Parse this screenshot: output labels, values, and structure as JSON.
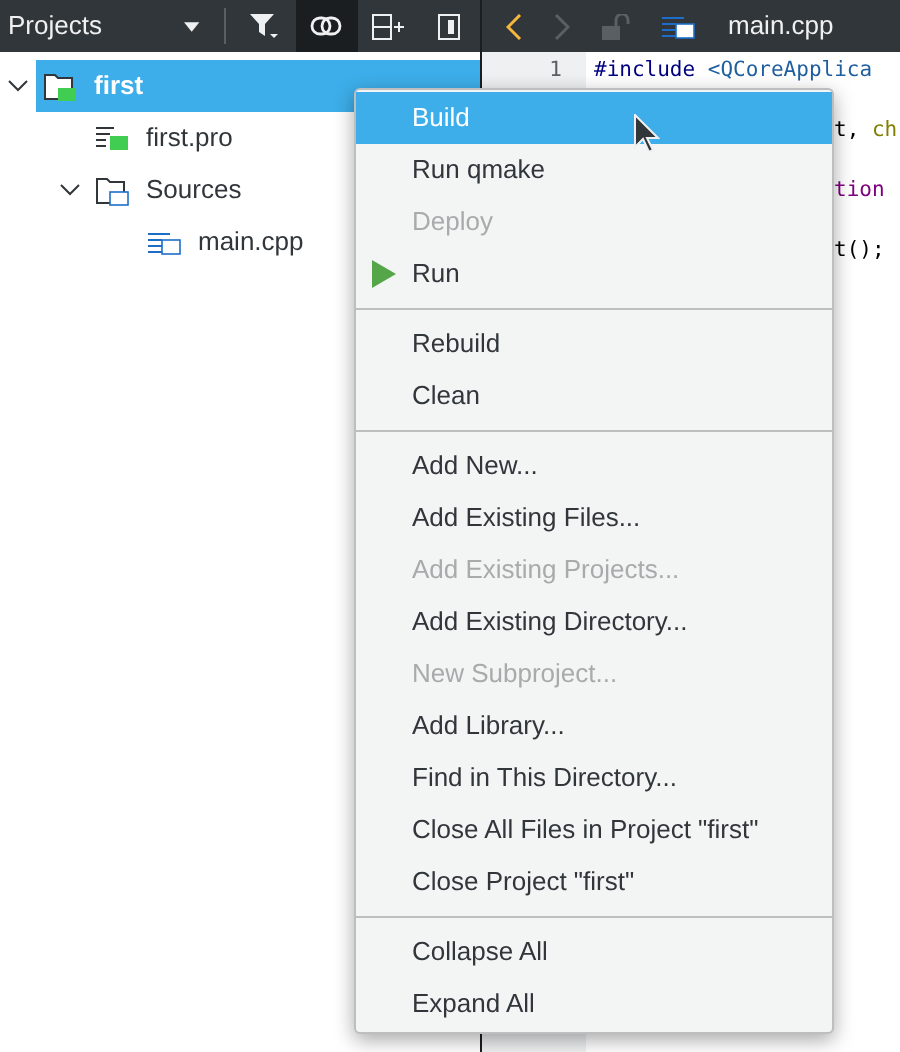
{
  "sidebar": {
    "title": "Projects",
    "tools": [
      {
        "kind": "filter",
        "selected": false
      },
      {
        "kind": "link",
        "selected": true
      },
      {
        "kind": "split",
        "selected": false
      },
      {
        "kind": "close",
        "selected": false
      }
    ],
    "tree": [
      {
        "label": "first",
        "kind": "project",
        "selected": true,
        "expanded": true,
        "children": [
          {
            "label": "first.pro",
            "kind": "profile",
            "selected": false
          },
          {
            "label": "Sources",
            "kind": "folder",
            "selected": false,
            "expanded": true,
            "children": [
              {
                "label": "main.cpp",
                "kind": "source",
                "selected": false
              }
            ]
          }
        ]
      }
    ]
  },
  "editor": {
    "toolbar": {
      "file_name": "main.cpp"
    },
    "line_numbers": [
      "1"
    ],
    "lines": [
      [
        {
          "text": "#include",
          "kind": "directive"
        },
        {
          "text": "<QCoreApplica",
          "kind": "include"
        }
      ],
      [
        {
          "text": "t,",
          "kind": "plain"
        },
        {
          "text": "ch",
          "kind": "keyword"
        }
      ],
      [
        {
          "text": "tion",
          "kind": "macro"
        }
      ],
      [
        {
          "text": "t();",
          "kind": "plain"
        }
      ]
    ]
  },
  "context_menu": [
    {
      "kind": "item",
      "label": "Build",
      "selected": true,
      "disabled": false
    },
    {
      "kind": "item",
      "label": "Run qmake",
      "selected": false,
      "disabled": false
    },
    {
      "kind": "item",
      "label": "Deploy",
      "selected": false,
      "disabled": true
    },
    {
      "kind": "play",
      "label": "Run",
      "selected": false,
      "disabled": false
    },
    {
      "kind": "separator"
    },
    {
      "kind": "item",
      "label": "Rebuild",
      "selected": false,
      "disabled": false
    },
    {
      "kind": "item",
      "label": "Clean",
      "selected": false,
      "disabled": false
    },
    {
      "kind": "separator"
    },
    {
      "kind": "item",
      "label": "Add New...",
      "selected": false,
      "disabled": false
    },
    {
      "kind": "item",
      "label": "Add Existing Files...",
      "selected": false,
      "disabled": false
    },
    {
      "kind": "item",
      "label": "Add Existing Projects...",
      "selected": false,
      "disabled": true
    },
    {
      "kind": "item",
      "label": "Add Existing Directory...",
      "selected": false,
      "disabled": false
    },
    {
      "kind": "item",
      "label": "New Subproject...",
      "selected": false,
      "disabled": true
    },
    {
      "kind": "item",
      "label": "Add Library...",
      "selected": false,
      "disabled": false
    },
    {
      "kind": "item",
      "label": "Find in This Directory...",
      "selected": false,
      "disabled": false
    },
    {
      "kind": "item",
      "label": "Close All Files in Project \"first\"",
      "selected": false,
      "disabled": false
    },
    {
      "kind": "item",
      "label": "Close Project \"first\"",
      "selected": false,
      "disabled": false
    },
    {
      "kind": "separator"
    },
    {
      "kind": "item",
      "label": "Collapse All",
      "selected": false,
      "disabled": false
    },
    {
      "kind": "item",
      "label": "Expand All",
      "selected": false,
      "disabled": false
    }
  ]
}
